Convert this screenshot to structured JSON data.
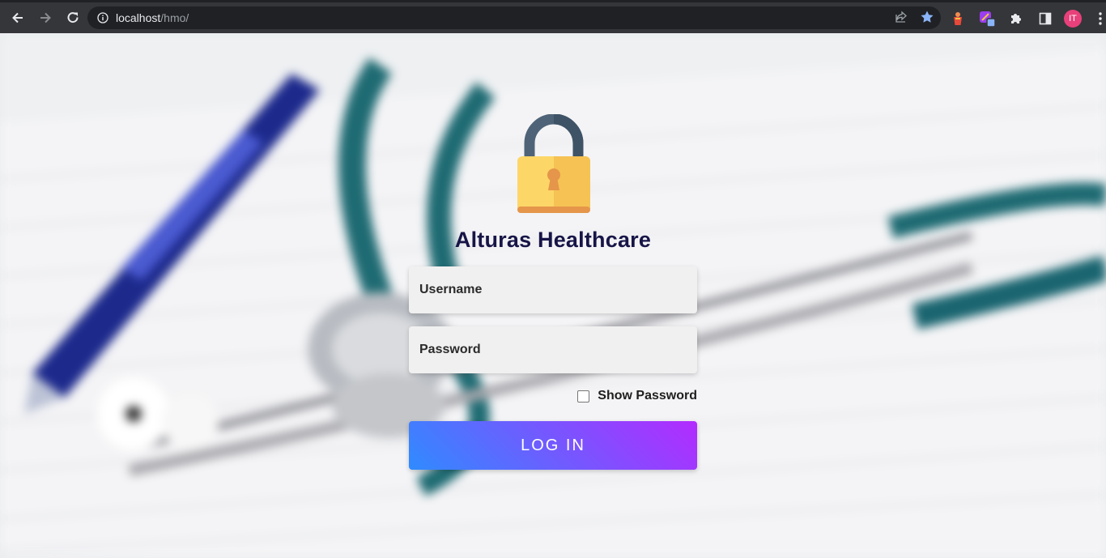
{
  "browser": {
    "url_host": "localhost",
    "url_path": "/hmo/",
    "profile_initials": "IT"
  },
  "icons": {
    "back": "arrow-left-icon",
    "forward": "arrow-right-icon",
    "reload": "reload-icon",
    "site_info": "info-icon",
    "share": "share-icon",
    "bookmark": "star-icon",
    "extensions": "puzzle-icon",
    "side_panel": "side-panel-icon",
    "menu": "kebab-menu-icon",
    "lock": "padlock-icon"
  },
  "colors": {
    "title": "#171547",
    "button_gradient_start": "#2f8bff",
    "button_gradient_end": "#b32bff",
    "bookmark_star": "#8ab4f8"
  },
  "login": {
    "title": "Alturas Healthcare",
    "username_placeholder": "Username",
    "password_placeholder": "Password",
    "show_password_label": "Show Password",
    "submit_label": "LOG IN"
  }
}
